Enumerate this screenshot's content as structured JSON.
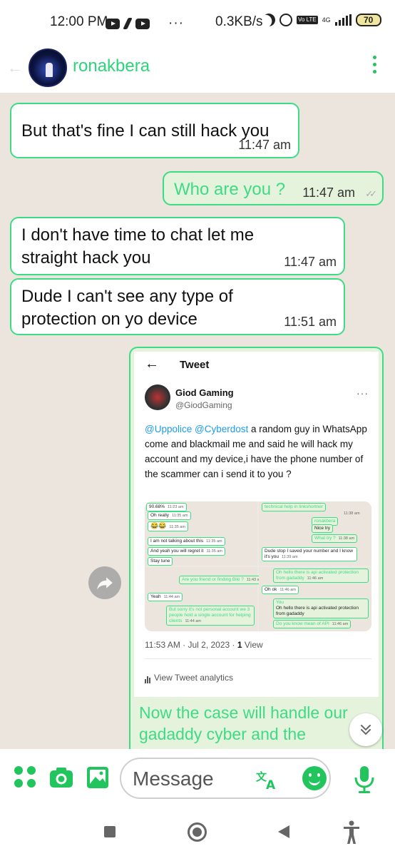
{
  "status_bar": {
    "time": "12:00 PM",
    "more": "···",
    "speed": "0.3KB/s",
    "volte": "Vo LTE",
    "network": "4G",
    "battery": "70"
  },
  "header": {
    "contact_name": "ronakbera"
  },
  "messages": [
    {
      "direction": "in",
      "text": "But that's fine I can still hack you",
      "time": "11:47 am"
    },
    {
      "direction": "out",
      "text": "Who are you ?",
      "time": "11:47 am"
    },
    {
      "direction": "in",
      "text": "I don't have time to chat let me straight hack you",
      "time": "11:47 am"
    },
    {
      "direction": "in",
      "text": "Dude I can't see any type of protection on yo device",
      "time": "11:51 am"
    }
  ],
  "image_message": {
    "tweet": {
      "header": "Tweet",
      "author_name": "Giod Gaming",
      "author_handle": "@GiodGaming",
      "mention1": "@Uppolice",
      "mention2": "@Cyberdost",
      "body": " a random guy in WhatsApp come and blackmail me and said he will hack my account and my device,i have the phone number of the scammer can i send it to you ?",
      "timestamp": "11:53 AM · Jul 2, 2023 · ",
      "views_count": "1",
      "views_label": "View",
      "analytics": "View Tweet analytics",
      "screenshot_texts": {
        "p1": [
          "90.68%",
          "Oh really",
          "😂😂",
          "I am not talking about this",
          "And yeah you will regret it",
          "Stay tune"
        ],
        "p1_times": [
          "11:23 am",
          "11:35 am",
          "11:35 am",
          "11:35 am",
          "11:35 am",
          ""
        ],
        "p2": [
          "technical help in linkshortner",
          "ronakbera",
          "Nice try",
          "What try ?",
          "Dude stop I saved your number and I know it's you"
        ],
        "p2_times": [
          "11:38 am",
          "",
          "",
          "11:38 am",
          "11:39 am"
        ],
        "p3": [
          "Are you friend or finding Biki ?",
          "Yeah",
          "But sorry it's not personal account we 3 people hold a single account for helping clients"
        ],
        "p3_times": [
          "11:43 am",
          "11:44 am",
          "11:44 am"
        ],
        "p4": [
          "Oh hello there is api activated protection from gadaddy",
          "Oh ok",
          "You",
          "Oh hello there is api activated protection from gadaddy",
          "Do you know mean of API"
        ],
        "p4_times": [
          "11:46 am",
          "11:46 am",
          "",
          "",
          "11:46 am"
        ]
      }
    },
    "caption": "Now the case will handle our gadaddy cyber and the"
  },
  "input_bar": {
    "placeholder": "Message"
  },
  "colors": {
    "accent": "#3ddc84",
    "accent_dark": "#22c45e",
    "chat_bg": "#ece5dd",
    "outgoing_bg": "#e6f3dc"
  }
}
